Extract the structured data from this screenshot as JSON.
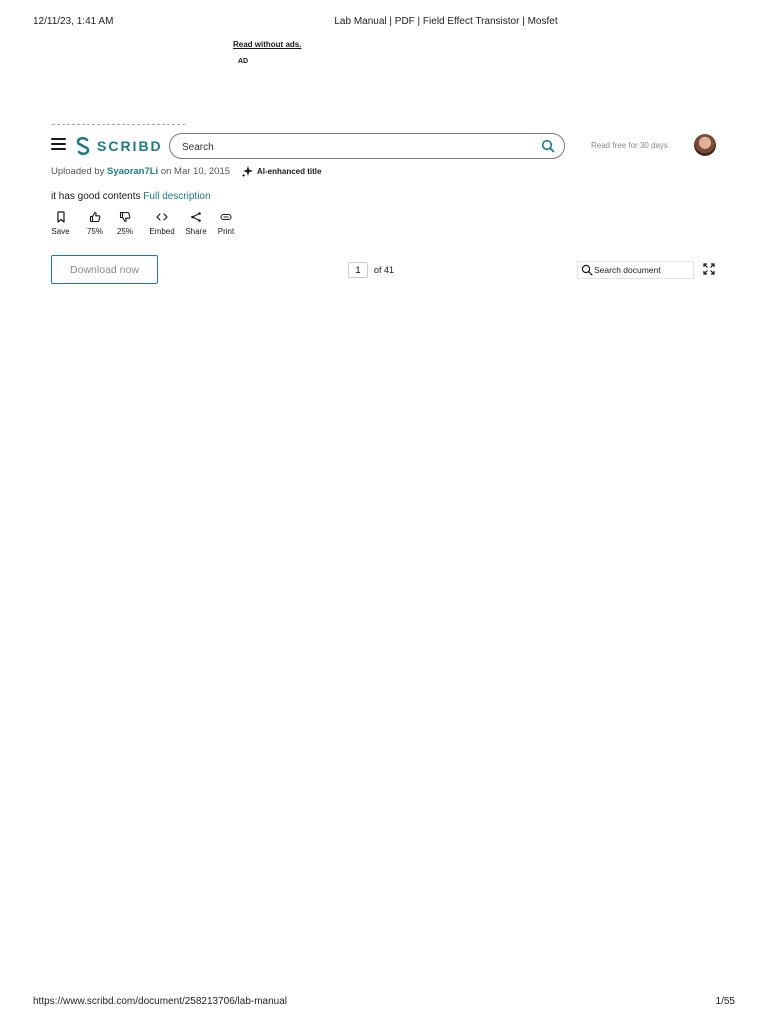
{
  "print": {
    "datetime": "12/11/23, 1:41 AM",
    "title": "Lab Manual | PDF | Field Effect Transistor | Mosfet",
    "url": "https://www.scribd.com/document/258213706/lab-manual",
    "page": "1/55"
  },
  "ad": {
    "read_without_ads": "Read without ads.",
    "label": "AD"
  },
  "nav": {
    "logo_text": "SCRIBD",
    "search_placeholder": "Search",
    "read_free": "Read free for 30 days"
  },
  "doc": {
    "uploaded_prefix": "Uploaded by ",
    "uploader": "Syaoran7Li",
    "uploaded_suffix": " on Mar 10, 2015",
    "ai_title": "AI-enhanced title",
    "description": "it has good contents ",
    "full_description": "Full description"
  },
  "actions": {
    "save": "Save",
    "like": "75%",
    "dislike": "25%",
    "embed": "Embed",
    "share": "Share",
    "print": "Print"
  },
  "viewer": {
    "download": "Download now",
    "current_page": "1",
    "of_pages": "of 41",
    "search_doc_placeholder": "Search document"
  },
  "colors": {
    "brand": "#1e7b85"
  }
}
